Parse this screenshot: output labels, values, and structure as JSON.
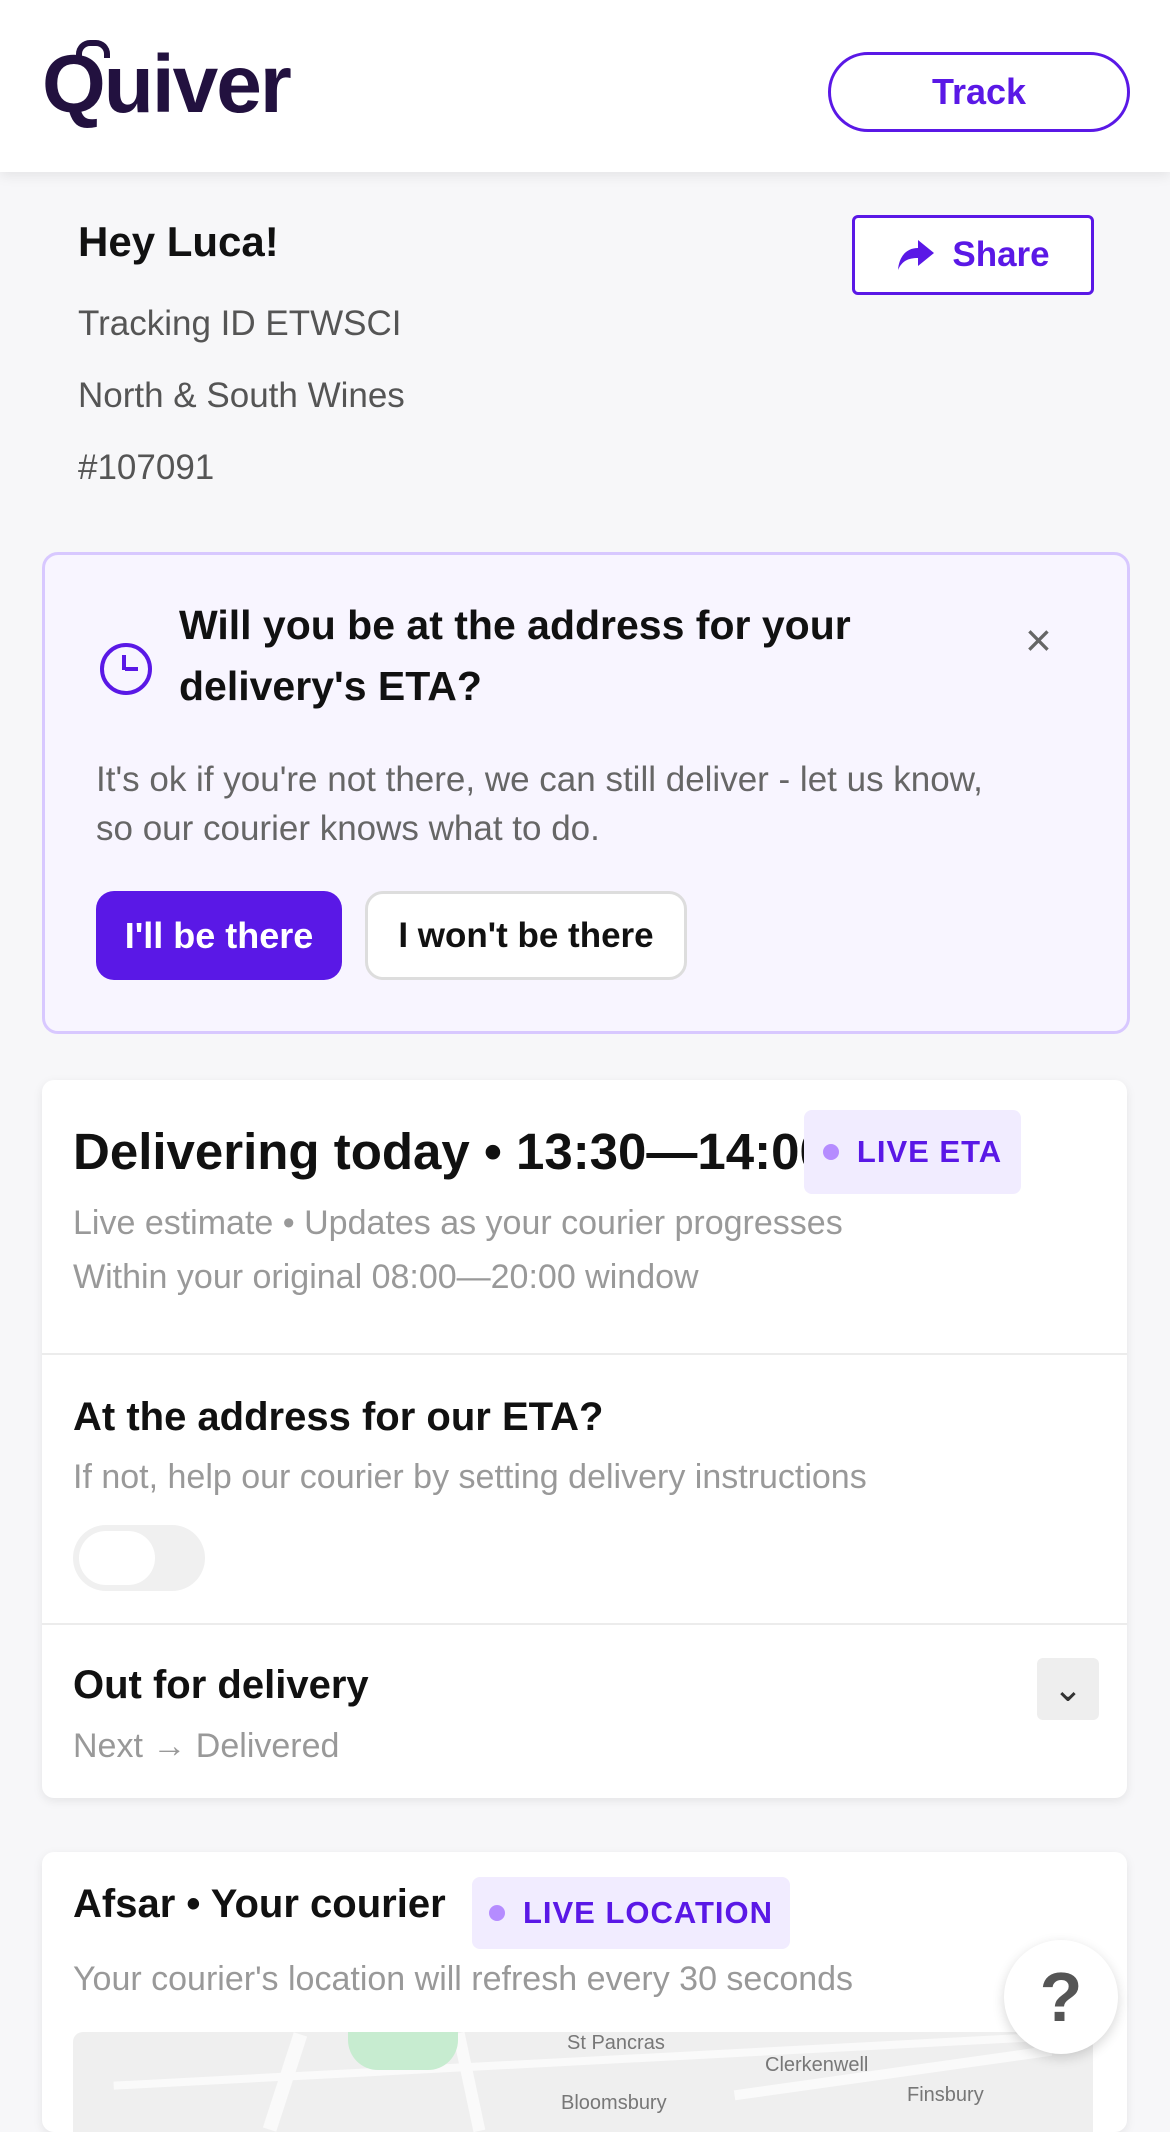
{
  "header": {
    "brand": "Quiver",
    "track_label": "Track"
  },
  "order": {
    "greeting": "Hey Luca!",
    "tracking_id": "Tracking ID ETWSCI",
    "merchant": "North & South Wines",
    "order_number": "#107091",
    "share_label": "Share"
  },
  "availability_notice": {
    "title": "Will you be at the address for your delivery's ETA?",
    "body": "It's ok if you're not there, we can still deliver - let us know, so our courier knows what to do.",
    "primary_button": "I'll be there",
    "secondary_button": "I won't be there"
  },
  "delivery": {
    "title": "Delivering today • 13:30—14:00",
    "badge": "LIVE ETA",
    "estimate_note": "Live estimate • Updates as your courier progresses",
    "window_note": "Within your original 08:00—20:00 window",
    "address_question": "At the address for our ETA?",
    "address_help": "If not, help our courier by setting delivery instructions",
    "status": "Out for delivery",
    "next_step": "Next → Delivered"
  },
  "courier": {
    "title": "Afsar • Your courier",
    "badge": "LIVE LOCATION",
    "refresh_note": "Your courier's location will refresh every 30 seconds",
    "map_labels": [
      "St Pancras",
      "Clerkenwell",
      "Bloomsbury",
      "Finsbury"
    ]
  },
  "help_label": "?",
  "colors": {
    "accent": "#5A18E6",
    "brand": "#22113F",
    "notice_bg": "#F8F5FF",
    "badge_bg": "#F1ECFF"
  },
  "icons": {
    "share": "share-arrow-icon",
    "clock": "clock-icon",
    "close": "close-icon",
    "chevron": "chevron-down-icon"
  }
}
